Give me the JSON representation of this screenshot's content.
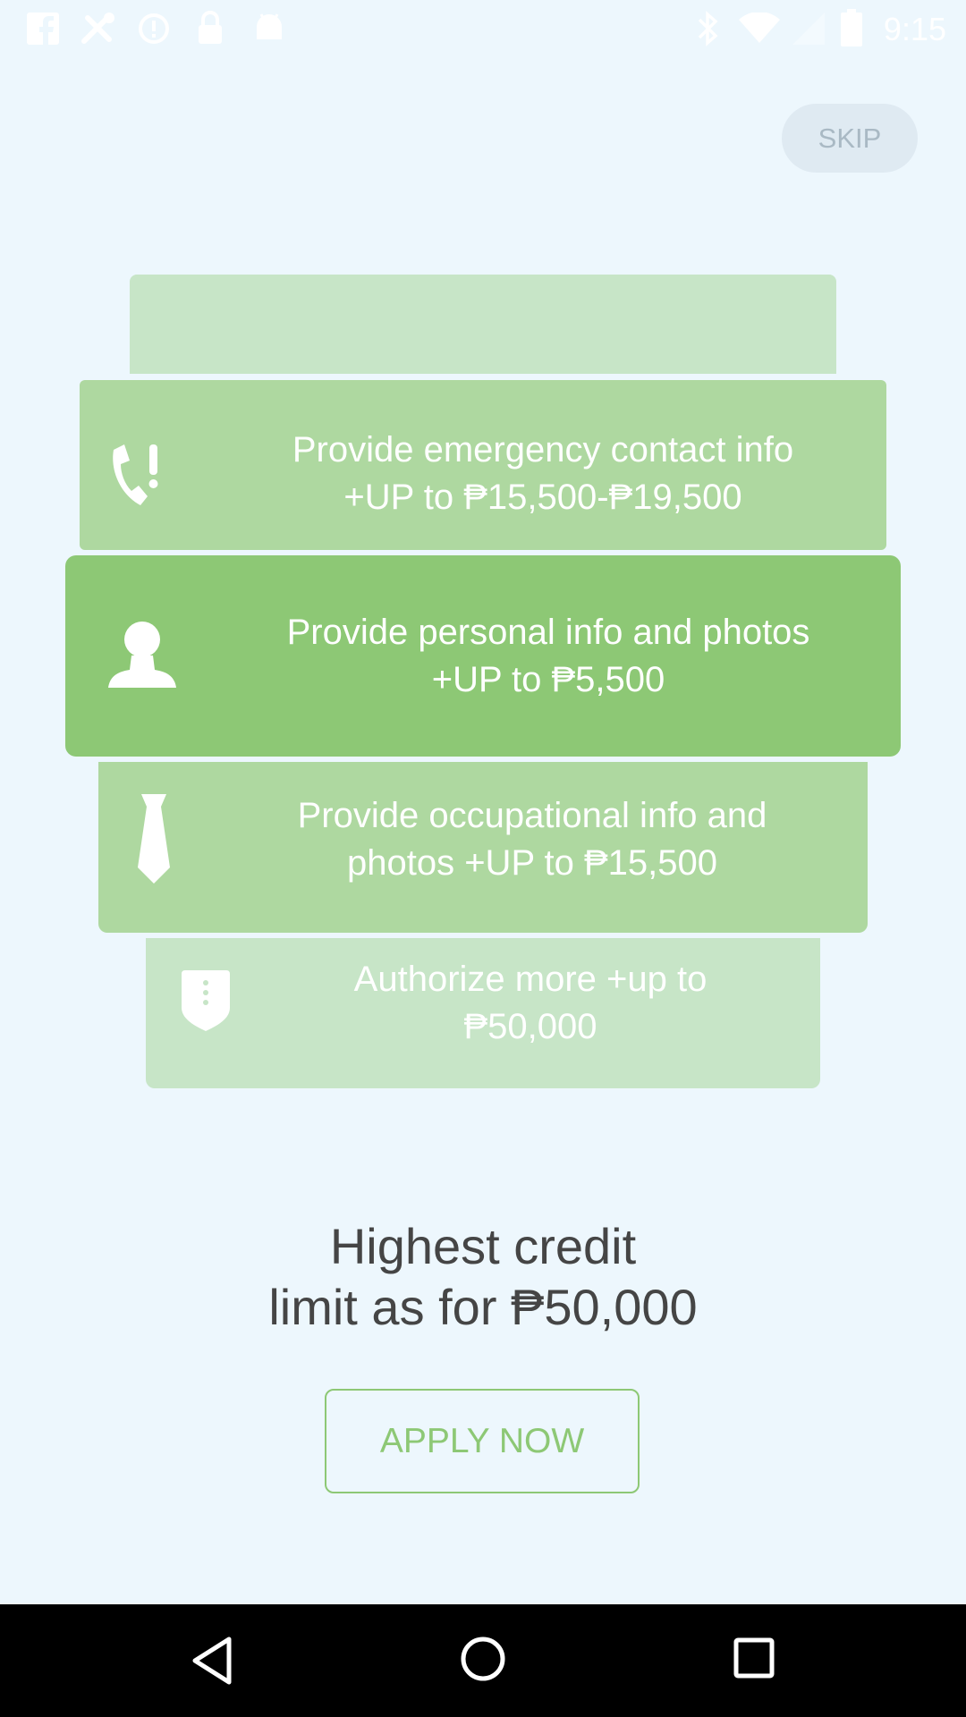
{
  "status_bar": {
    "time": "9:15",
    "left_icons": [
      "facebook-icon",
      "tools-icon",
      "alert-icon",
      "lock-icon",
      "android-icon"
    ],
    "right_icons": [
      "bluetooth-icon",
      "wifi-icon",
      "signal-icon",
      "battery-icon"
    ]
  },
  "skip_label": "SKIP",
  "steps": [
    {
      "icon": "emergency-phone-icon",
      "line1": "Provide emergency contact info",
      "line2": "+UP to ₱15,500-₱19,500"
    },
    {
      "icon": "person-icon",
      "line1": "Provide personal info and photos",
      "line2": "+UP to ₱5,500"
    },
    {
      "icon": "tie-icon",
      "line1": "Provide occupational info and",
      "line2": "photos +UP to ₱15,500"
    },
    {
      "icon": "shield-icon",
      "line1": "Authorize more +up to",
      "line2": "₱50,000"
    }
  ],
  "headline": {
    "line1": "Highest credit",
    "line2": "limit as for ₱50,000"
  },
  "apply_label": "APPLY NOW",
  "nav_bar": {
    "icons": [
      "back-icon",
      "home-icon",
      "recents-icon"
    ]
  },
  "colors": {
    "background": "#edf7fd",
    "accent_green": "#8dc875",
    "card_mid_green": "#aed8a0",
    "card_light_green": "#c7e5c7",
    "headline_text": "#454545"
  }
}
